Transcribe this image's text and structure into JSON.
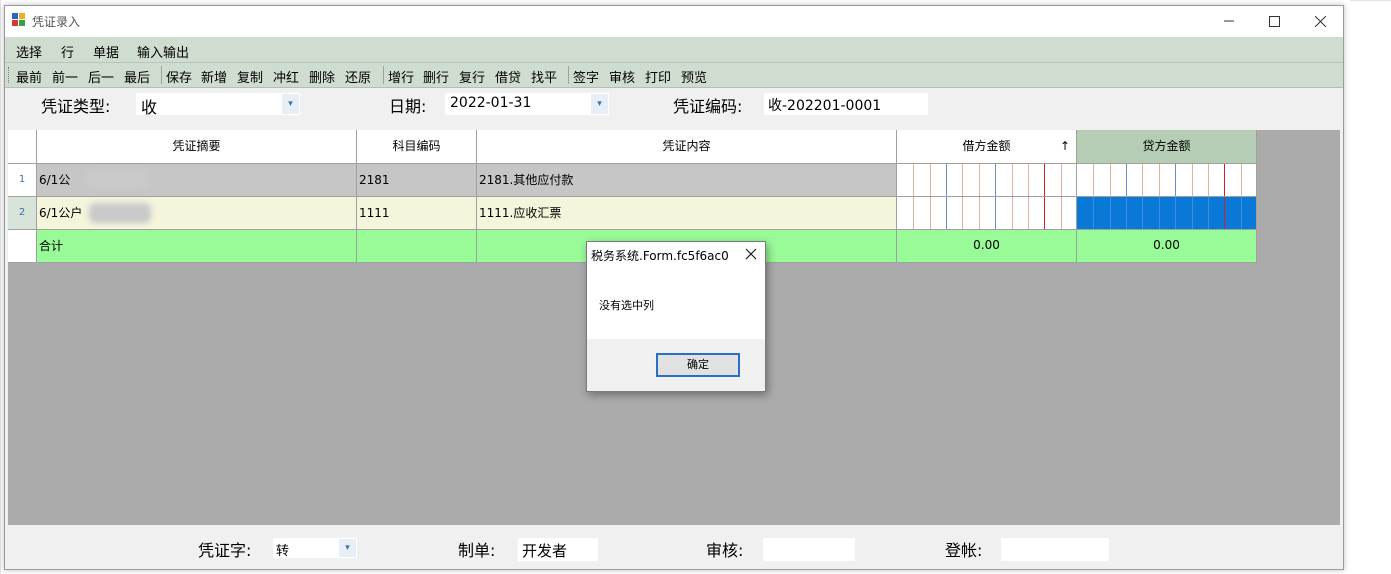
{
  "window": {
    "title": "凭证录入",
    "controls": {
      "minimize": "minimize-icon",
      "maximize": "maximize-icon",
      "close": "close-icon"
    }
  },
  "menu": [
    "选择",
    "行",
    "单据",
    "输入输出"
  ],
  "toolbar": [
    "最前",
    "前一",
    "后一",
    "最后",
    "保存",
    "新增",
    "复制",
    "冲红",
    "删除",
    "还原",
    "增行",
    "删行",
    "复行",
    "借贷",
    "找平",
    "签字",
    "审核",
    "打印",
    "预览"
  ],
  "header_form": {
    "type_label": "凭证类型:",
    "type_value": "收",
    "date_label": "日期:",
    "date_value": "2022-01-31",
    "code_label": "凭证编码:",
    "code_value": "收-202201-0001"
  },
  "grid": {
    "columns": [
      "凭证摘要",
      "科目编码",
      "凭证内容",
      "借方金额",
      "贷方金额"
    ],
    "sort_indicator": "↑",
    "rows": [
      {
        "num": "1",
        "summary": "6/1公",
        "code": "2181",
        "content": "2181.其他应付款"
      },
      {
        "num": "2",
        "summary": "6/1公户",
        "code": "1111",
        "content": "1111.应收汇票"
      }
    ],
    "total": {
      "label": "合计",
      "debit": "0.00",
      "credit": "0.00"
    }
  },
  "dialog": {
    "title": "税务系统.Form.fc5f6ac0",
    "message": "没有选中列",
    "ok": "确定"
  },
  "footer": {
    "word_label": "凭证字:",
    "word_value": "转",
    "maker_label": "制单:",
    "maker_value": "开发者",
    "review_label": "审核:",
    "review_value": "",
    "post_label": "登帐:",
    "post_value": ""
  },
  "colors": {
    "menu_bg": "#cfdcd0",
    "total_row": "#98fb98",
    "selected_row": "#f5f5dc",
    "credit_header": "#b4cdb4",
    "highlight_blue": "#0a78d7"
  }
}
